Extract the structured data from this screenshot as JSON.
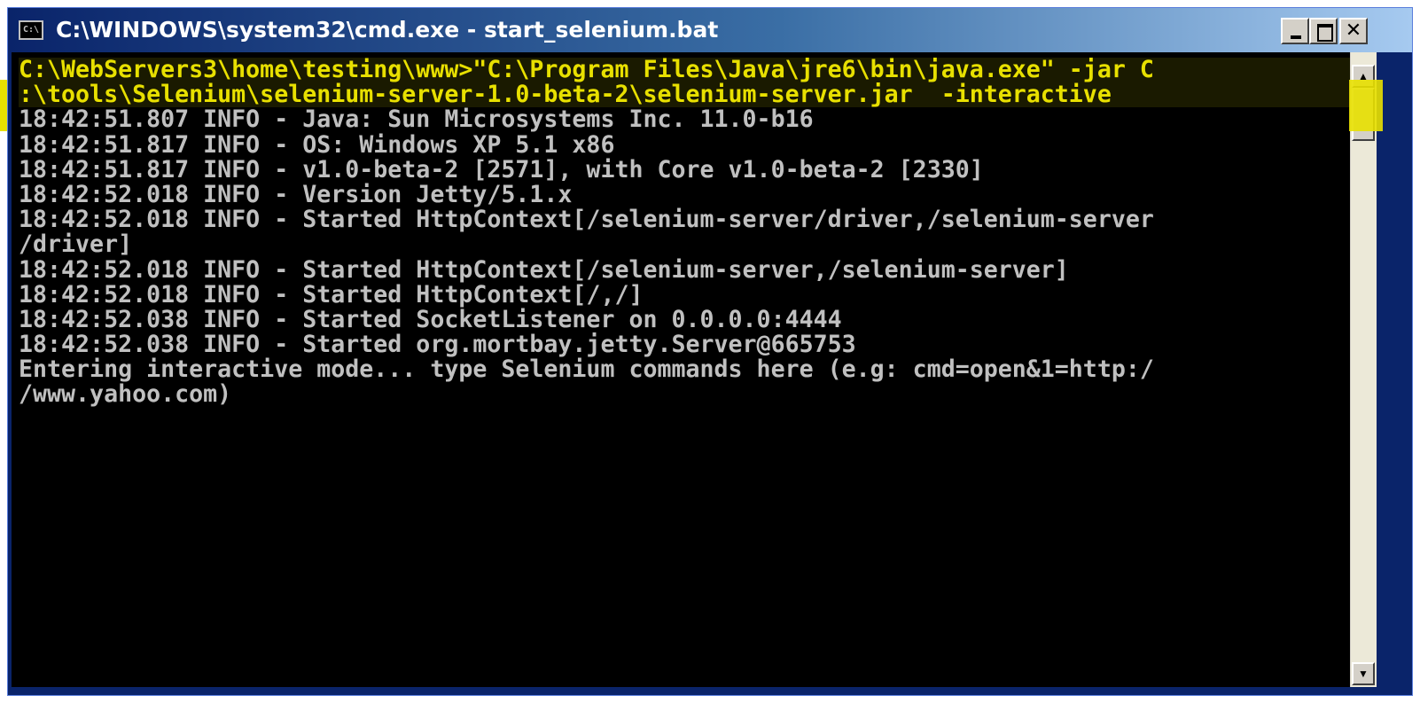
{
  "window": {
    "title": "C:\\WINDOWS\\system32\\cmd.exe - start_selenium.bat",
    "icon_label": "C:\\",
    "controls": {
      "minimize_icon": "minimize-icon",
      "maximize_icon": "maximize-icon",
      "close_label": "✕"
    }
  },
  "console": {
    "highlight_color": "#e8e000",
    "text_color": "#c0c0c0",
    "background_color": "#000000",
    "lines": [
      "C:\\WebServers3\\home\\testing\\www>\"C:\\Program Files\\Java\\jre6\\bin\\java.exe\" -jar C",
      ":\\tools\\Selenium\\selenium-server-1.0-beta-2\\selenium-server.jar  -interactive",
      "18:42:51.807 INFO - Java: Sun Microsystems Inc. 11.0-b16",
      "18:42:51.817 INFO - OS: Windows XP 5.1 x86",
      "18:42:51.817 INFO - v1.0-beta-2 [2571], with Core v1.0-beta-2 [2330]",
      "18:42:52.018 INFO - Version Jetty/5.1.x",
      "18:42:52.018 INFO - Started HttpContext[/selenium-server/driver,/selenium-server",
      "/driver]",
      "18:42:52.018 INFO - Started HttpContext[/selenium-server,/selenium-server]",
      "18:42:52.018 INFO - Started HttpContext[/,/]",
      "18:42:52.038 INFO - Started SocketListener on 0.0.0.0:4444",
      "18:42:52.038 INFO - Started org.mortbay.jetty.Server@665753",
      "Entering interactive mode... type Selenium commands here (e.g: cmd=open&1=http:/",
      "/www.yahoo.com)"
    ]
  },
  "scrollbar": {
    "up_label": "▲",
    "down_label": "▼"
  }
}
